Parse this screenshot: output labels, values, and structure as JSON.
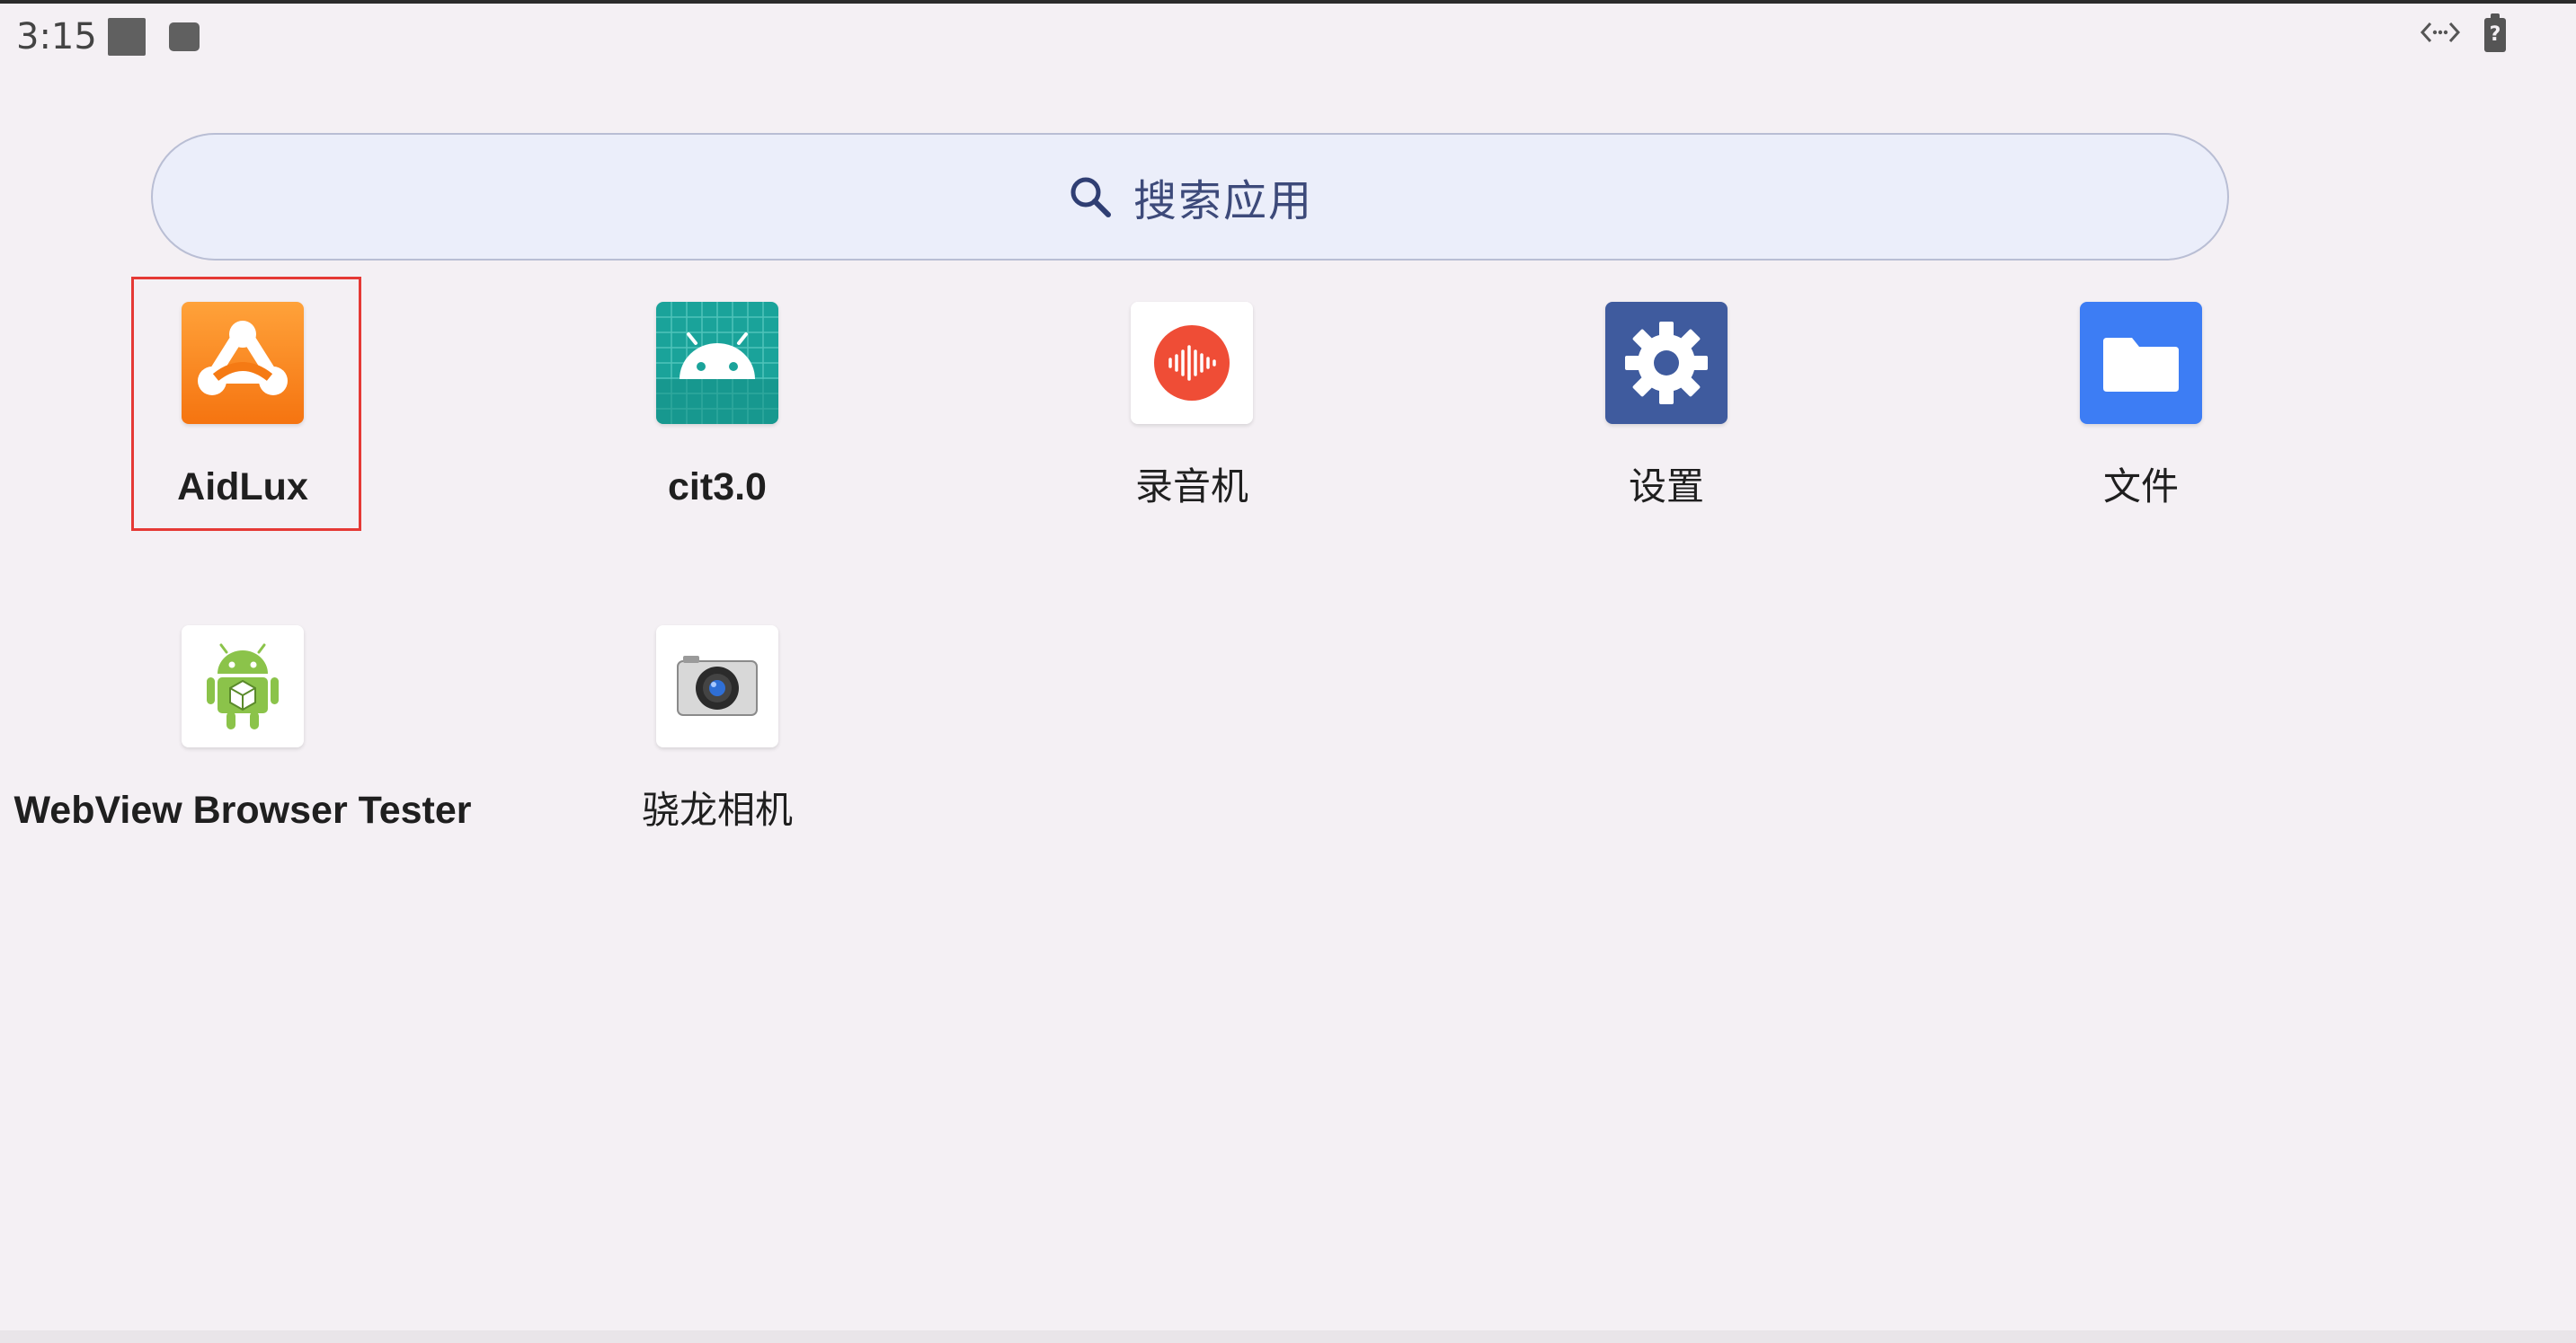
{
  "status_bar": {
    "time": "3:15",
    "icons": [
      "notification-square-icon",
      "notification-small-square-icon",
      "data-arrows-icon",
      "battery-unknown-icon"
    ],
    "battery_glyph": "?"
  },
  "search": {
    "placeholder": "搜索应用",
    "icon": "search-icon"
  },
  "apps": [
    {
      "label": "AidLux",
      "icon": "aidlux-icon",
      "color": "#f7821b",
      "selected": true
    },
    {
      "label": "cit3.0",
      "icon": "android-grid-icon",
      "color": "#1aa39a"
    },
    {
      "label": "录音机",
      "icon": "recorder-icon",
      "color": "#ef4d36"
    },
    {
      "label": "设置",
      "icon": "settings-gear-icon",
      "color": "#3f5b9e"
    },
    {
      "label": "文件",
      "icon": "folder-icon",
      "color": "#3d7df4"
    },
    {
      "label": "WebView Browser Tester",
      "icon": "android-robot-icon",
      "color": "#8bc34a"
    },
    {
      "label": "骁龙相机",
      "icon": "camera-icon",
      "color": "#3a3a3a"
    }
  ],
  "colors": {
    "background": "#f4f0f4",
    "selection_border": "#e53935",
    "search_fill": "#ebeefa"
  }
}
